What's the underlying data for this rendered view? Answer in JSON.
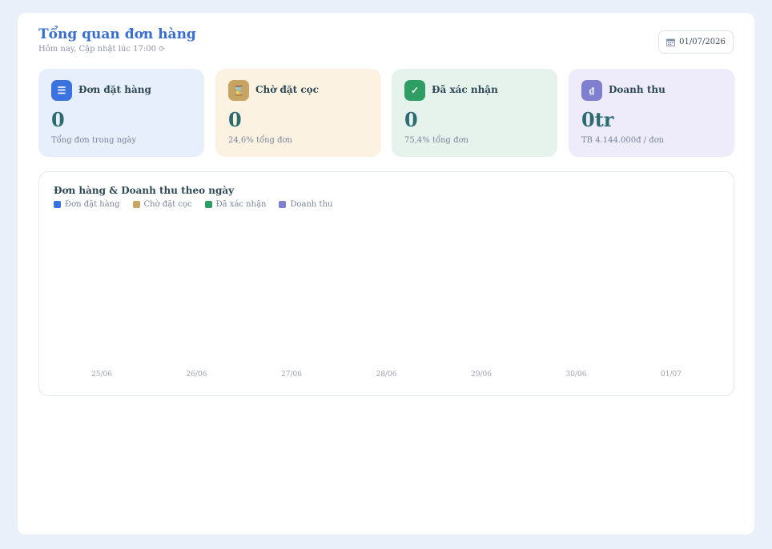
{
  "header": {
    "title": "Tổng quan đơn hàng",
    "subtitle": "Hôm nay, Cập nhật lúc 17:00",
    "date": "01/07/2026"
  },
  "cards": [
    {
      "label": "Đơn đặt hàng",
      "value": "0",
      "note": "Tổng đơn trong ngày",
      "icon": "list-icon",
      "glyph": "☰",
      "color": "#3a72e0",
      "bg": "#e7eefc"
    },
    {
      "label": "Chờ đặt cọc",
      "value": "0",
      "note": "24,6% tổng đơn",
      "icon": "hourglass-icon",
      "glyph": "⌛",
      "color": "#c6a461",
      "bg": "#fcf2e2"
    },
    {
      "label": "Đã xác nhận",
      "value": "0",
      "note": "75,4% tổng đơn",
      "icon": "check-icon",
      "glyph": "✓",
      "color": "#2f9e63",
      "bg": "#e6f3ed"
    },
    {
      "label": "Doanh thu",
      "value": "0tr",
      "note": "TB 4.144.000đ / đơn",
      "icon": "dong-icon",
      "glyph": "₫",
      "color": "#7f7fd0",
      "bg": "#eeecfb"
    }
  ],
  "chart_data": {
    "type": "bar",
    "title": "Đơn hàng & Doanh thu theo ngày",
    "categories": [
      "25/06",
      "26/06",
      "27/06",
      "28/06",
      "29/06",
      "30/06",
      "01/07"
    ],
    "series": [
      {
        "name": "Đơn đặt hàng",
        "color": "#3a72e0",
        "values": [
          0,
          0,
          0,
          0,
          0,
          0,
          0
        ]
      },
      {
        "name": "Chờ đặt cọc",
        "color": "#c6a461",
        "values": [
          0,
          0,
          0,
          0,
          0,
          0,
          0
        ]
      },
      {
        "name": "Đã xác nhận",
        "color": "#2f9e63",
        "values": [
          0,
          0,
          0,
          0,
          0,
          0,
          0
        ]
      },
      {
        "name": "Doanh thu",
        "color": "#7f7fd0",
        "values": [
          0,
          0,
          0,
          0,
          0,
          0,
          0
        ]
      }
    ]
  }
}
